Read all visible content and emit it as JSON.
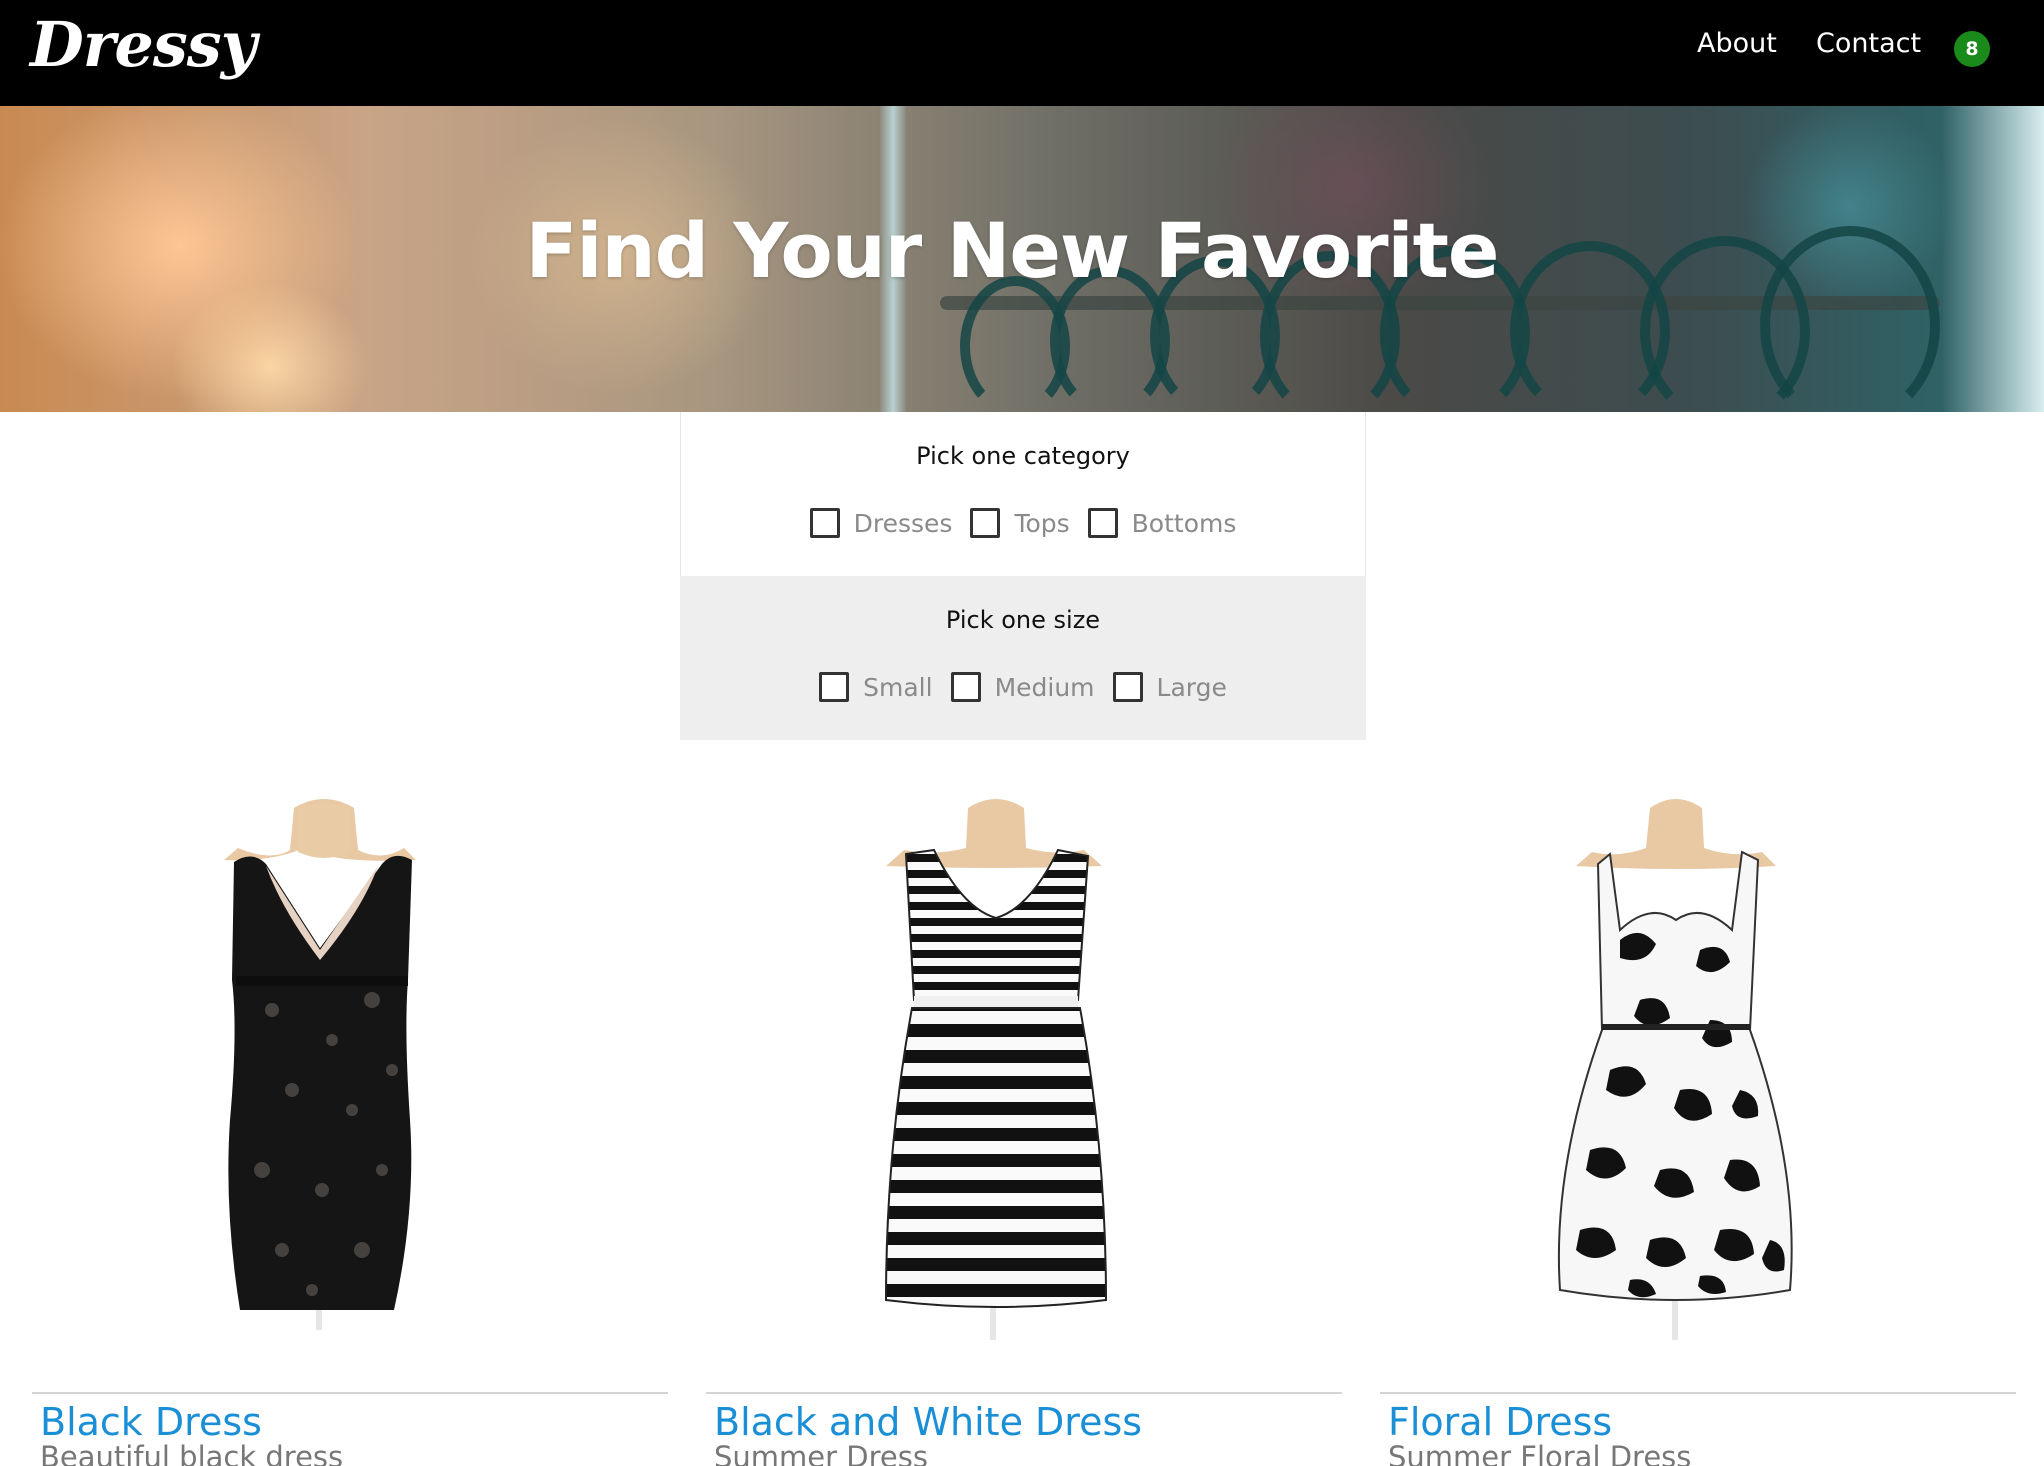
{
  "brand": {
    "logo_text": "Dressy"
  },
  "nav": {
    "about_label": "About",
    "contact_label": "Contact",
    "cart_count": "8"
  },
  "hero": {
    "title": "Find Your New Favorite"
  },
  "filters": {
    "category": {
      "heading": "Pick one category",
      "options": [
        "Dresses",
        "Tops",
        "Bottoms"
      ]
    },
    "size": {
      "heading": "Pick one size",
      "options": [
        "Small",
        "Medium",
        "Large"
      ]
    }
  },
  "products": [
    {
      "name": "Black Dress",
      "description": "Beautiful black dress"
    },
    {
      "name": "Black and White Dress",
      "description": "Summer Dress"
    },
    {
      "name": "Floral Dress",
      "description": "Summer Floral Dress"
    }
  ],
  "colors": {
    "navbar_bg": "#000000",
    "cart_badge": "#1a8a1a",
    "product_link": "#1a8fd6",
    "size_panel_bg": "#eeeeee"
  }
}
